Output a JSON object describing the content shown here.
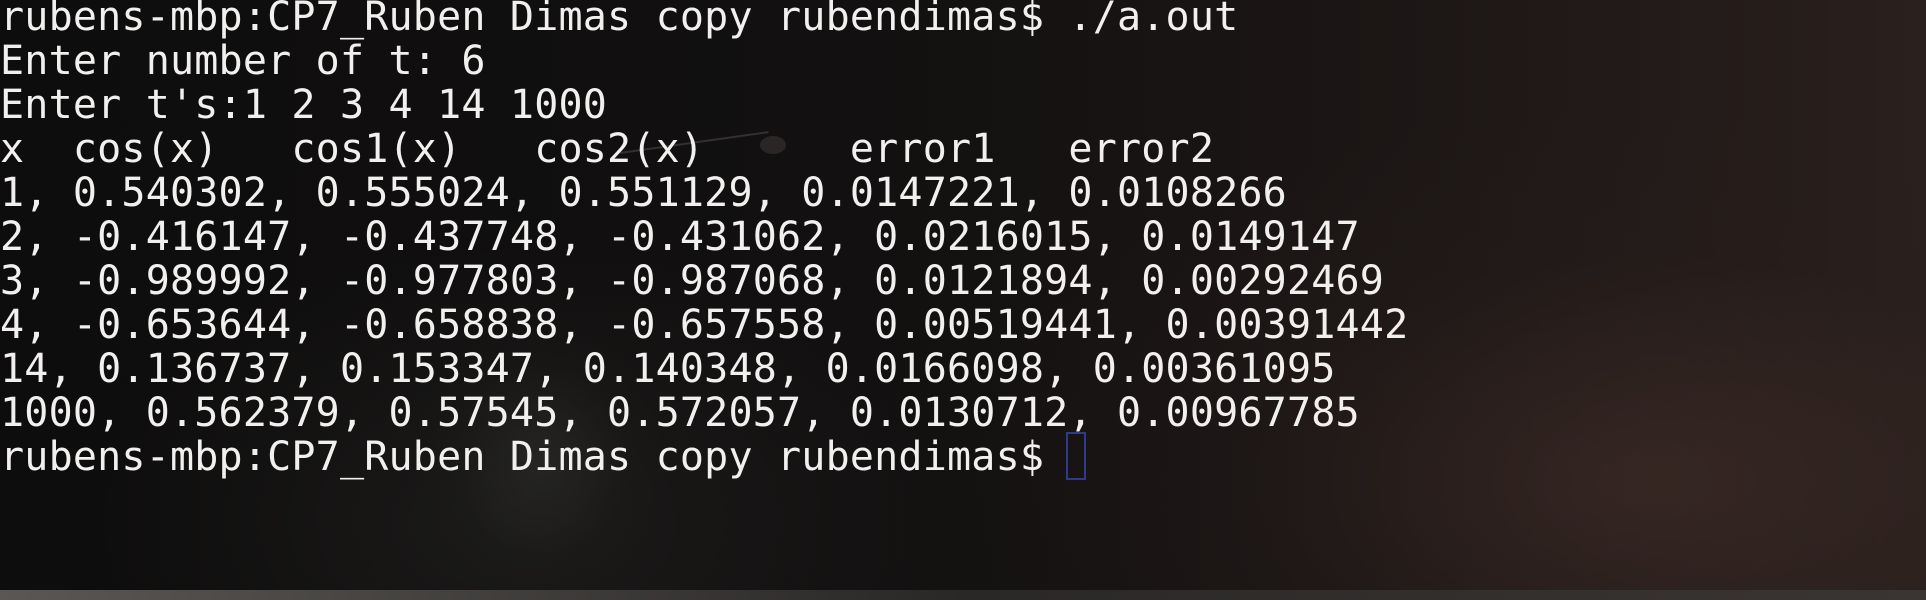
{
  "terminal": {
    "lines": [
      "rubens-mbp:CP7_Ruben Dimas copy rubendimas$ ./a.out",
      "Enter number of t: 6",
      "Enter t's:1 2 3 4 14 1000",
      "x  cos(x)   cos1(x)   cos2(x)      error1   error2",
      "1, 0.540302, 0.555024, 0.551129, 0.0147221, 0.0108266",
      "2, -0.416147, -0.437748, -0.431062, 0.0216015, 0.0149147",
      "3, -0.989992, -0.977803, -0.987068, 0.0121894, 0.00292469",
      "4, -0.653644, -0.658838, -0.657558, 0.00519441, 0.00391442",
      "14, 0.136737, 0.153347, 0.140348, 0.0166098, 0.00361095",
      "1000, 0.562379, 0.57545, 0.572057, 0.0130712, 0.00967785"
    ],
    "prompt": "rubens-mbp:CP7_Ruben Dimas copy rubendimas$"
  },
  "colors": {
    "text": "#f2f0ee",
    "cursor_border": "#2f3a8a",
    "background": "#0f0d0d"
  }
}
